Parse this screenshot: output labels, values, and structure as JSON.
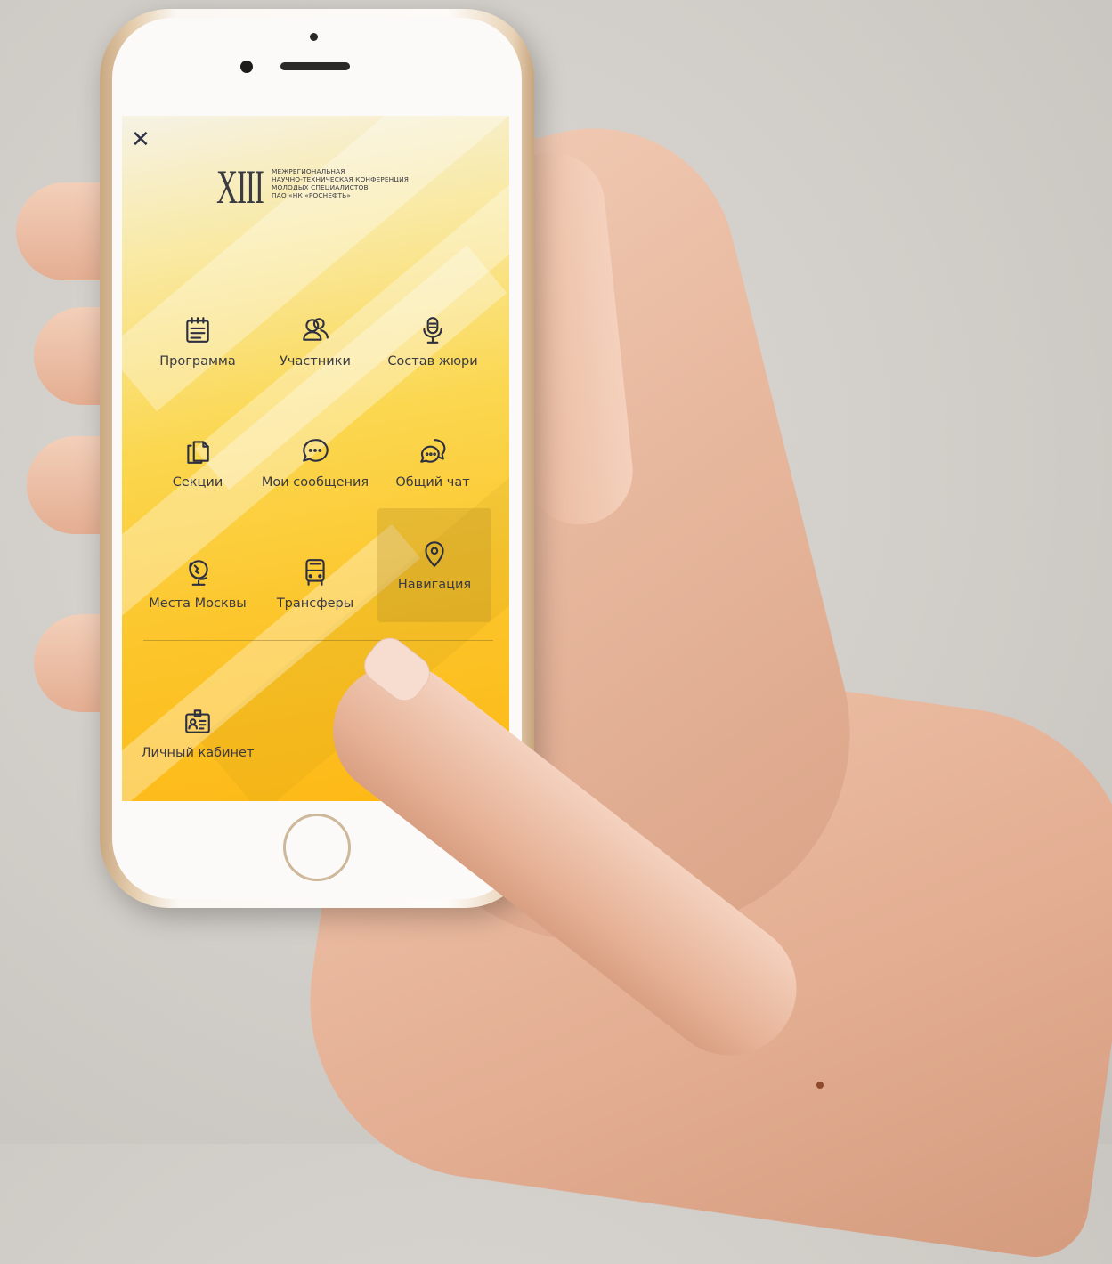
{
  "app": {
    "close_icon": "close-icon",
    "logo": {
      "numeral": "XIII",
      "lines": [
        "МЕЖРЕГИОНАЛЬНАЯ",
        "НАУЧНО-ТЕХНИЧЕСКАЯ КОНФЕРЕНЦИЯ",
        "МОЛОДЫХ СПЕЦИАЛИСТОВ",
        "ПАО «НК «РОСНЕФТЬ»"
      ]
    },
    "menu": [
      {
        "label": "Программа",
        "icon": "calendar-icon"
      },
      {
        "label": "Участники",
        "icon": "users-icon"
      },
      {
        "label": "Состав жюри",
        "icon": "microphone-icon"
      },
      {
        "label": "Секции",
        "icon": "documents-icon"
      },
      {
        "label": "Мои сообщения",
        "icon": "message-icon"
      },
      {
        "label": "Общий чат",
        "icon": "group-chat-icon"
      },
      {
        "label": "Места Москвы",
        "icon": "globe-icon"
      },
      {
        "label": "Трансферы",
        "icon": "bus-icon"
      },
      {
        "label": "Навигация",
        "icon": "location-pin-icon",
        "active": true
      }
    ],
    "profile": {
      "label": "Личный кабинет",
      "icon": "id-card-icon"
    },
    "colors": {
      "accent": "#fdb814",
      "icon": "#2e3040",
      "text": "#3a3a44"
    }
  }
}
